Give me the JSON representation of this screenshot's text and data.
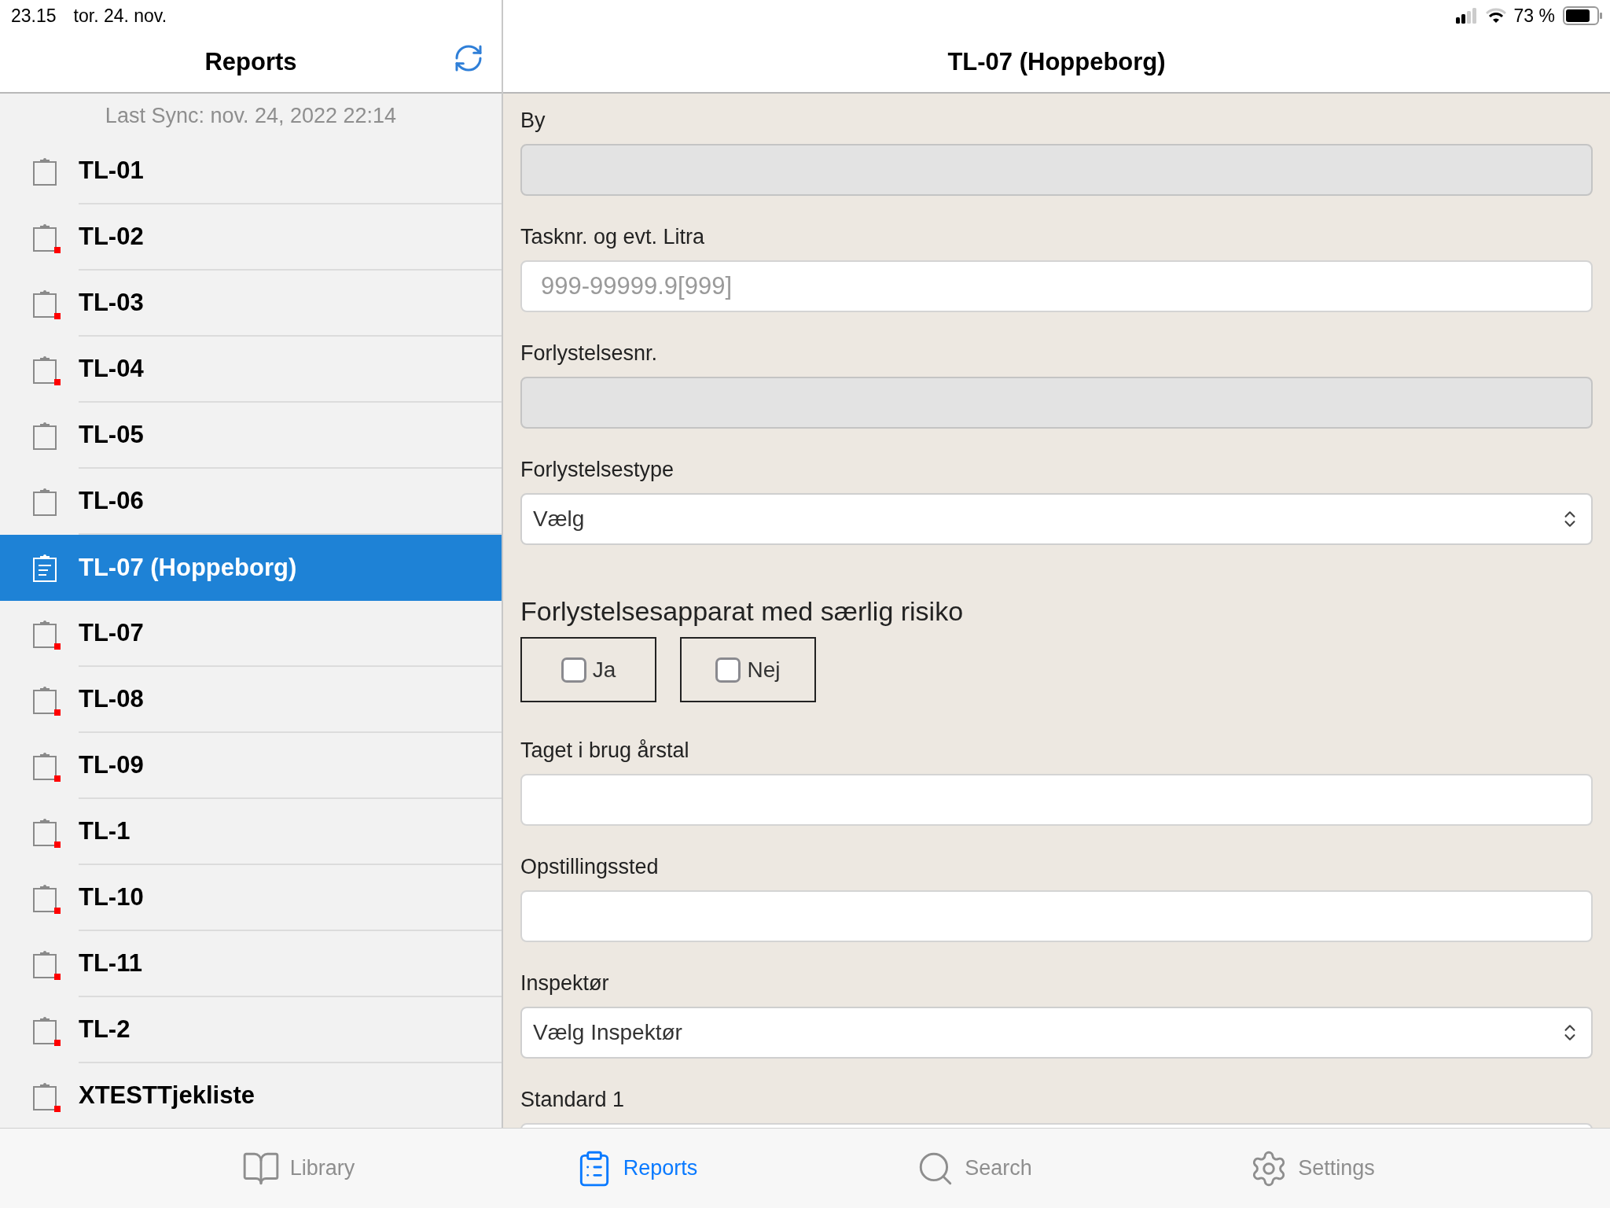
{
  "status_bar": {
    "time": "23.15",
    "date": "tor. 24. nov.",
    "battery": "73 %"
  },
  "sidebar": {
    "title": "Reports",
    "last_sync": "Last Sync: nov. 24, 2022 22:14",
    "items": [
      {
        "label": "TL-01",
        "selected": false,
        "flagged": false
      },
      {
        "label": "TL-02",
        "selected": false,
        "flagged": true
      },
      {
        "label": "TL-03",
        "selected": false,
        "flagged": true
      },
      {
        "label": "TL-04",
        "selected": false,
        "flagged": true
      },
      {
        "label": "TL-05",
        "selected": false,
        "flagged": false
      },
      {
        "label": "TL-06",
        "selected": false,
        "flagged": false
      },
      {
        "label": "TL-07 (Hoppeborg)",
        "selected": true,
        "flagged": false
      },
      {
        "label": "TL-07",
        "selected": false,
        "flagged": true
      },
      {
        "label": "TL-08",
        "selected": false,
        "flagged": true
      },
      {
        "label": "TL-09",
        "selected": false,
        "flagged": true
      },
      {
        "label": "TL-1",
        "selected": false,
        "flagged": true
      },
      {
        "label": "TL-10",
        "selected": false,
        "flagged": true
      },
      {
        "label": "TL-11",
        "selected": false,
        "flagged": true
      },
      {
        "label": "TL-2",
        "selected": false,
        "flagged": true
      },
      {
        "label": "XTESTTjekliste",
        "selected": false,
        "flagged": true
      }
    ]
  },
  "detail": {
    "title": "TL-07 (Hoppeborg)",
    "items": [
      {
        "kind": "text",
        "label": "By",
        "disabled": true
      },
      {
        "kind": "text",
        "label": "Tasknr. og evt. Litra",
        "placeholder": "999-99999.9[999]",
        "disabled": false
      },
      {
        "kind": "text",
        "label": "Forlystelsesnr.",
        "disabled": true
      },
      {
        "kind": "select",
        "label": "Forlystelsestype",
        "value": "Vælg"
      },
      {
        "kind": "choice",
        "label": "Forlystelsesapparat med særlig risiko",
        "options": [
          {
            "label": "Ja",
            "checked": false
          },
          {
            "label": "Nej",
            "checked": false
          }
        ]
      },
      {
        "kind": "text",
        "label": "Taget i brug årstal",
        "disabled": false
      },
      {
        "kind": "text",
        "label": "Opstillingssted",
        "disabled": false
      },
      {
        "kind": "select",
        "label": "Inspektør",
        "value": "Vælg Inspektør"
      },
      {
        "kind": "text",
        "label": "Standard 1",
        "disabled": false
      }
    ]
  },
  "tab_bar": [
    {
      "label": "Library",
      "selected": false
    },
    {
      "label": "Reports",
      "selected": true
    },
    {
      "label": "Search",
      "selected": false
    },
    {
      "label": "Settings",
      "selected": false
    }
  ]
}
